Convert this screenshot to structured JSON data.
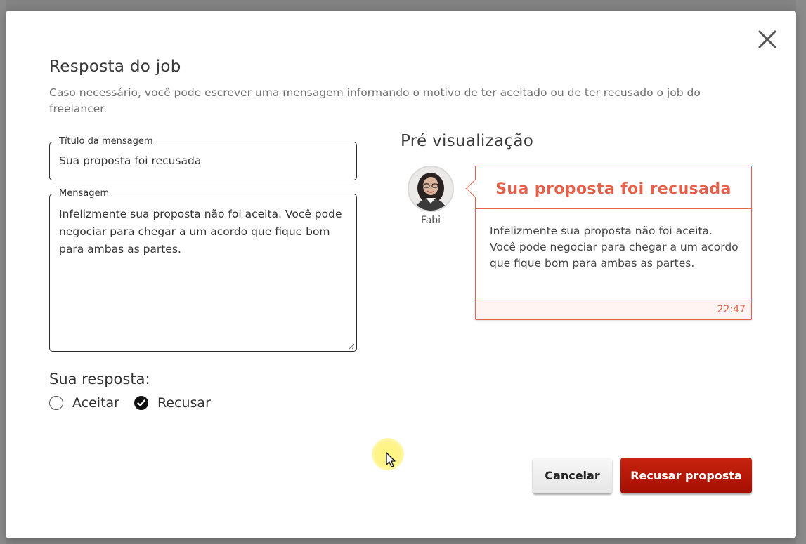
{
  "modal": {
    "title": "Resposta do job",
    "description": "Caso necessário, você pode escrever uma mensagem informando o motivo de ter aceitado ou de ter recusado o job do freelancer."
  },
  "form": {
    "title_field": {
      "label": "Título da mensagem",
      "value": "Sua proposta foi recusada"
    },
    "message_field": {
      "label": "Mensagem",
      "value": "Infelizmente sua proposta não foi aceita. Você pode negociar para chegar a um acordo que fique bom para ambas as partes."
    },
    "answer": {
      "label": "Sua resposta:",
      "options": [
        {
          "label": "Aceitar",
          "checked": false
        },
        {
          "label": "Recusar",
          "checked": true
        }
      ]
    }
  },
  "preview": {
    "title": "Pré visualização",
    "sender_name": "Fabi",
    "bubble_title": "Sua proposta foi recusada",
    "bubble_body": "Infelizmente sua proposta não foi aceita. Você pode negociar para chegar a um acordo que fique bom para ambas as partes.",
    "time": "22:47"
  },
  "actions": {
    "cancel_label": "Cancelar",
    "confirm_label": "Recusar proposta"
  },
  "colors": {
    "accent": "#e5604a",
    "confirm_button": "#b81a07",
    "overlay": "#828282"
  },
  "icons": {
    "close": "close-icon",
    "check": "check-icon",
    "avatar": "user-avatar",
    "cursor": "mouse-cursor"
  }
}
